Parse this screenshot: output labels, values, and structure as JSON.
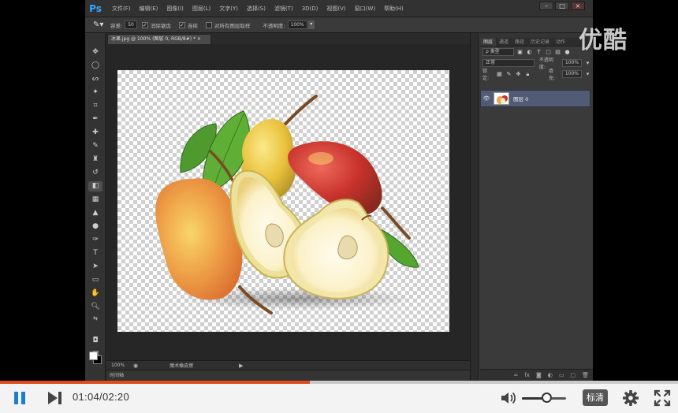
{
  "watermark": "优酷",
  "photoshop": {
    "logo": "Ps",
    "menu": [
      "文件(F)",
      "编辑(E)",
      "图像(I)",
      "图层(L)",
      "文字(Y)",
      "选择(S)",
      "滤镜(T)",
      "3D(D)",
      "视图(V)",
      "窗口(W)",
      "帮助(H)"
    ],
    "window_controls": [
      "–",
      "□",
      "×"
    ],
    "options": {
      "tolerance_label": "容差:",
      "tolerance_value": "50",
      "antialias_label": "消除锯齿",
      "contiguous_label": "连续",
      "sample_all_label": "对所有图层取样",
      "opacity_label": "不透明度:",
      "opacity_value": "100%"
    },
    "doc_tab": "冰果.jpg @ 100% (图层 0, RGB/8#) *  ×",
    "status": {
      "zoom": "100%",
      "info": "魔术橡皮擦"
    },
    "timeline_tab": "时间轴",
    "panel": {
      "tabs": [
        "图层",
        "通道",
        "路径",
        "历史记录",
        "动作"
      ],
      "filter_label": "ρ 类型",
      "blend_mode": "正常",
      "opacity_label": "不透明度:",
      "opacity_value": "100%",
      "lock_label": "锁定:",
      "fill_label": "填充:",
      "fill_value": "100%",
      "layer_name": "图层 0"
    },
    "tools": [
      "move-icon",
      "ellipse-marquee-icon",
      "lasso-icon",
      "magic-wand-icon",
      "crop-icon",
      "eyedropper-icon",
      "brush-icon",
      "healing-icon",
      "stamp-icon",
      "history-brush-icon",
      "eraser-icon",
      "gradient-icon",
      "blur-icon",
      "dodge-icon",
      "pen-icon",
      "type-icon",
      "path-select-icon",
      "shape-icon",
      "hand-icon",
      "zoom-icon"
    ]
  },
  "player": {
    "current_time": "01:04",
    "duration": "02:20",
    "time_display": "01:04/02:20",
    "progress_fraction": 0.457,
    "volume_fraction": 0.55,
    "quality_label": "标清",
    "accent_color": "#e04a1c",
    "play_color": "#1a7fd4"
  }
}
